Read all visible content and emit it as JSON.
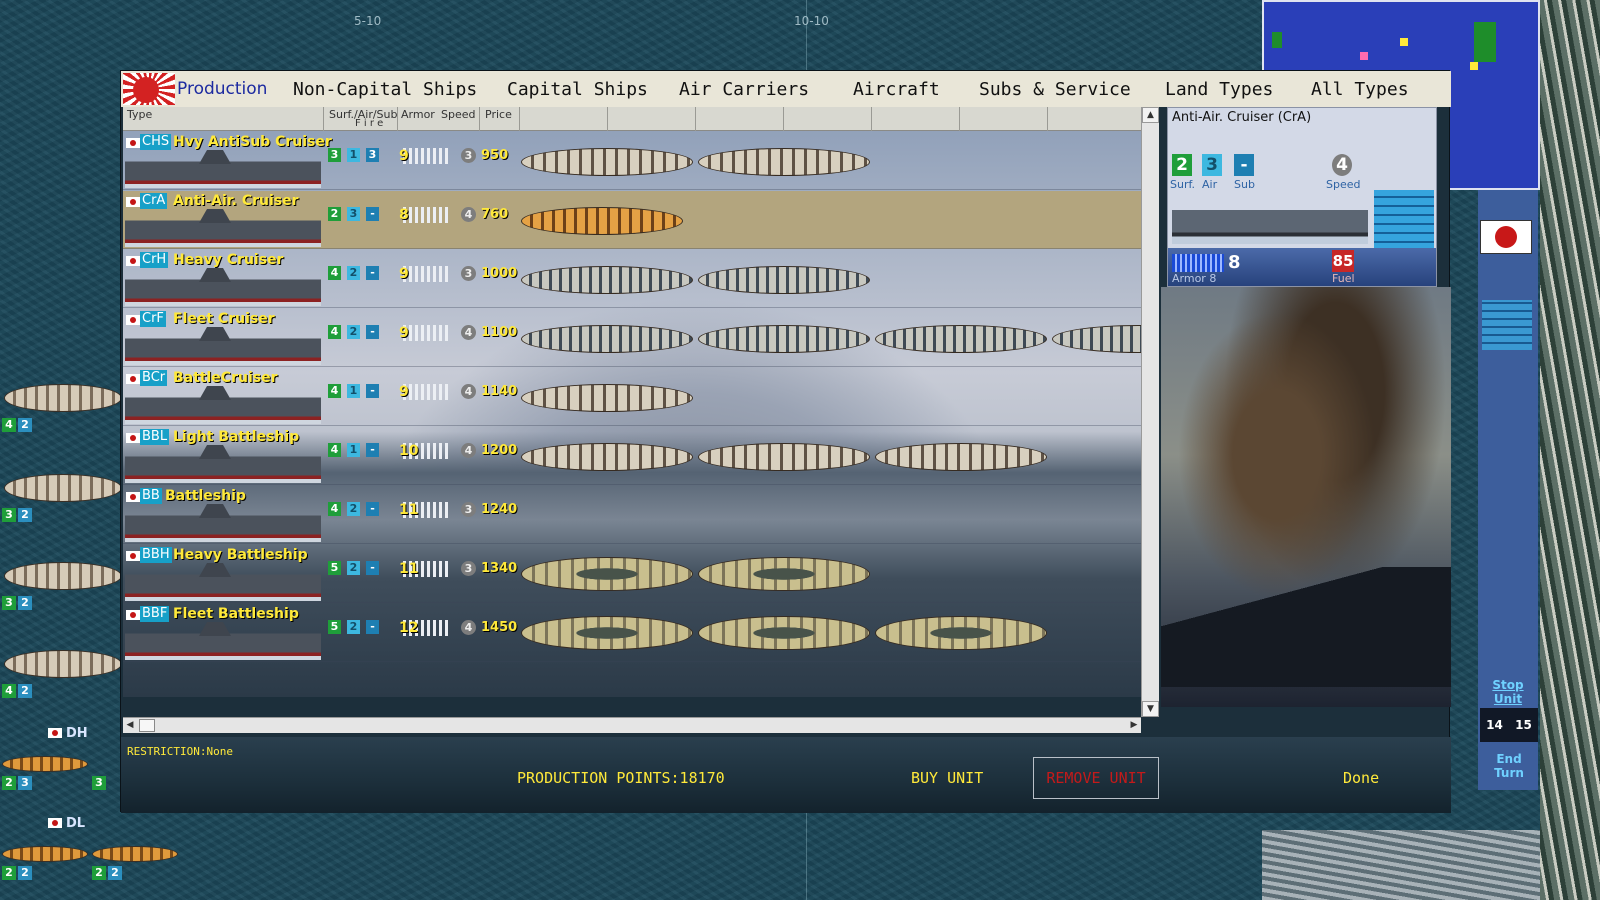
{
  "map": {
    "grid_labels": [
      "5-10",
      "10-10"
    ],
    "left_units": {
      "stacks": [
        {
          "surf": "4",
          "air": "2"
        },
        {
          "surf": "3",
          "air": "2"
        },
        {
          "surf": "3",
          "air": "2"
        },
        {
          "surf": "4",
          "air": "2"
        }
      ],
      "dh": {
        "tag": "DH",
        "surf": "2",
        "air": "3",
        "extra": "3"
      },
      "dl": {
        "tag": "DL",
        "stacks": [
          {
            "surf": "2",
            "air": "2"
          },
          {
            "surf": "2",
            "air": "2"
          }
        ]
      }
    },
    "side": {
      "stop_unit": "Stop Unit",
      "turn_numbers": [
        "14",
        "15"
      ],
      "end_turn": "End Turn"
    }
  },
  "tabs": {
    "production": "Production",
    "items": [
      "Non-Capital Ships",
      "Capital Ships",
      "Air Carriers",
      "Aircraft",
      "Subs & Service",
      "Land Types",
      "All Types"
    ]
  },
  "table": {
    "headers": {
      "type": "Type",
      "fire": "Surf./Air/Sub",
      "fire_sub": "F i r e",
      "armor": "Armor",
      "speed": "Speed",
      "price": "Price"
    },
    "rows": [
      {
        "code": "CHS",
        "name": "Hvy AntiSub Cruiser",
        "surf": "3",
        "air": "1",
        "sub": "3",
        "armor": "9",
        "speed": "3",
        "price": "950",
        "units": 2,
        "style": ""
      },
      {
        "code": "CrA",
        "name": "Anti-Air. Cruiser",
        "surf": "2",
        "air": "3",
        "sub": "-",
        "armor": "8",
        "speed": "4",
        "price": "760",
        "units": 1,
        "style": "orange",
        "selected": true
      },
      {
        "code": "CrH",
        "name": "Heavy Cruiser",
        "surf": "4",
        "air": "2",
        "sub": "-",
        "armor": "9",
        "speed": "3",
        "price": "1000",
        "units": 2,
        "style": "grey"
      },
      {
        "code": "CrF",
        "name": "Fleet Cruiser",
        "surf": "4",
        "air": "2",
        "sub": "-",
        "armor": "9",
        "speed": "4",
        "price": "1100",
        "units": 4,
        "style": "grey"
      },
      {
        "code": "BCr",
        "name": "BattleCruiser",
        "surf": "4",
        "air": "1",
        "sub": "-",
        "armor": "9",
        "speed": "4",
        "price": "1140",
        "units": 1,
        "style": ""
      },
      {
        "code": "BBL",
        "name": "Light Battleship",
        "surf": "4",
        "air": "1",
        "sub": "-",
        "armor": "10",
        "speed": "4",
        "price": "1200",
        "units": 3,
        "style": ""
      },
      {
        "code": "BB",
        "name": "Battleship",
        "surf": "4",
        "air": "2",
        "sub": "-",
        "armor": "11",
        "speed": "3",
        "price": "1240",
        "units": 0,
        "style": ""
      },
      {
        "code": "BBH",
        "name": "Heavy Battleship",
        "surf": "5",
        "air": "2",
        "sub": "-",
        "armor": "11",
        "speed": "3",
        "price": "1340",
        "units": 2,
        "style": "bb"
      },
      {
        "code": "BBF",
        "name": "Fleet Battleship",
        "surf": "5",
        "air": "2",
        "sub": "-",
        "armor": "12",
        "speed": "4",
        "price": "1450",
        "units": 3,
        "style": "bb"
      }
    ]
  },
  "detail": {
    "title": "Anti-Air. Cruiser  (CrA)",
    "surf": "2",
    "air": "3",
    "sub": "-",
    "speed": "4",
    "surf_label": "Surf.",
    "air_label": "Air",
    "sub_label": "Sub",
    "speed_label": "Speed",
    "armor": "8",
    "armor_label": "Armor 8",
    "fuel": "85",
    "fuel_label": "Fuel"
  },
  "footer": {
    "restriction": "RESTRICTION:None",
    "production_points": "PRODUCTION POINTS:18170",
    "buy": "BUY UNIT",
    "remove": "REMOVE UNIT",
    "done": "Done"
  },
  "colors": {
    "yellow_text": "#ffe93a",
    "surf_green": "#1f9e3a",
    "air_cyan": "#3db8e0",
    "sub_blue": "#1e7fb2",
    "selected_row": "#b3a57e",
    "remove_red": "#c41a1a"
  },
  "icons": [
    "japan-flag-icon",
    "rising-sun-logo-icon",
    "scroll-up-icon",
    "scroll-down-icon",
    "scroll-left-icon",
    "scroll-right-icon",
    "radar-icon"
  ]
}
